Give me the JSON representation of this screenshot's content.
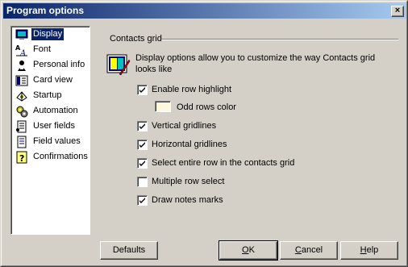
{
  "window": {
    "title": "Program options",
    "close_glyph": "×"
  },
  "nav": {
    "items": [
      {
        "label": "Display",
        "icon": "monitor-icon",
        "selected": true
      },
      {
        "label": "Font",
        "icon": "font-icon"
      },
      {
        "label": "Personal info",
        "icon": "person-icon"
      },
      {
        "label": "Card view",
        "icon": "card-icon"
      },
      {
        "label": "Startup",
        "icon": "startup-icon"
      },
      {
        "label": "Automation",
        "icon": "automation-icon"
      },
      {
        "label": "User fields",
        "icon": "user-fields-icon"
      },
      {
        "label": "Field values",
        "icon": "field-values-icon"
      },
      {
        "label": "Confirmations",
        "icon": "question-icon"
      }
    ]
  },
  "panel": {
    "group_title": "Contacts grid",
    "description": "Display options allow you to customize the way Contacts grid looks like",
    "options": {
      "row_highlight": {
        "label": "Enable row highlight",
        "checked": true
      },
      "odd_rows_color": {
        "label": "Odd rows color",
        "color": "#fff8dc"
      },
      "vertical_gridlines": {
        "label": "Vertical gridlines",
        "checked": true
      },
      "horizontal_gridlines": {
        "label": "Horizontal gridlines",
        "checked": true
      },
      "select_entire_row": {
        "label": "Select entire row in the contacts grid",
        "checked": true
      },
      "multiple_row_select": {
        "label": "Multiple row select",
        "checked": false
      },
      "draw_notes_marks": {
        "label": "Draw notes marks",
        "checked": true
      }
    }
  },
  "buttons": {
    "defaults": "Defaults",
    "ok": {
      "accel": "O",
      "rest": "K"
    },
    "cancel": {
      "accel": "C",
      "rest": "ancel"
    },
    "help": {
      "accel": "H",
      "rest": "elp"
    }
  },
  "colors": {
    "title_start": "#0a246a",
    "title_end": "#a6caf0",
    "selection": "#0a246a",
    "face": "#d4d0c8"
  }
}
